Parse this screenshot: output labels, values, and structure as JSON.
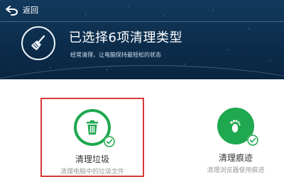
{
  "header": {
    "back_label": "返回",
    "title": "已选择6项清理类型",
    "subtitle": "经常清理，让电脑保持最轻松的状态",
    "broom_icon": "broom-icon"
  },
  "options": [
    {
      "title": "清理垃圾",
      "description": "清理电脑中的垃圾文件",
      "icon": "trash-bin-icon",
      "selected": true,
      "checked": true
    },
    {
      "title": "清理痕迹",
      "description": "清理浏览器使用痕迹",
      "icon": "footprint-icon",
      "selected": false,
      "checked": true
    }
  ],
  "colors": {
    "accent_green": "#1fa84f",
    "selection_border": "#d53b3b",
    "header_bg": "#0d2d4c"
  }
}
